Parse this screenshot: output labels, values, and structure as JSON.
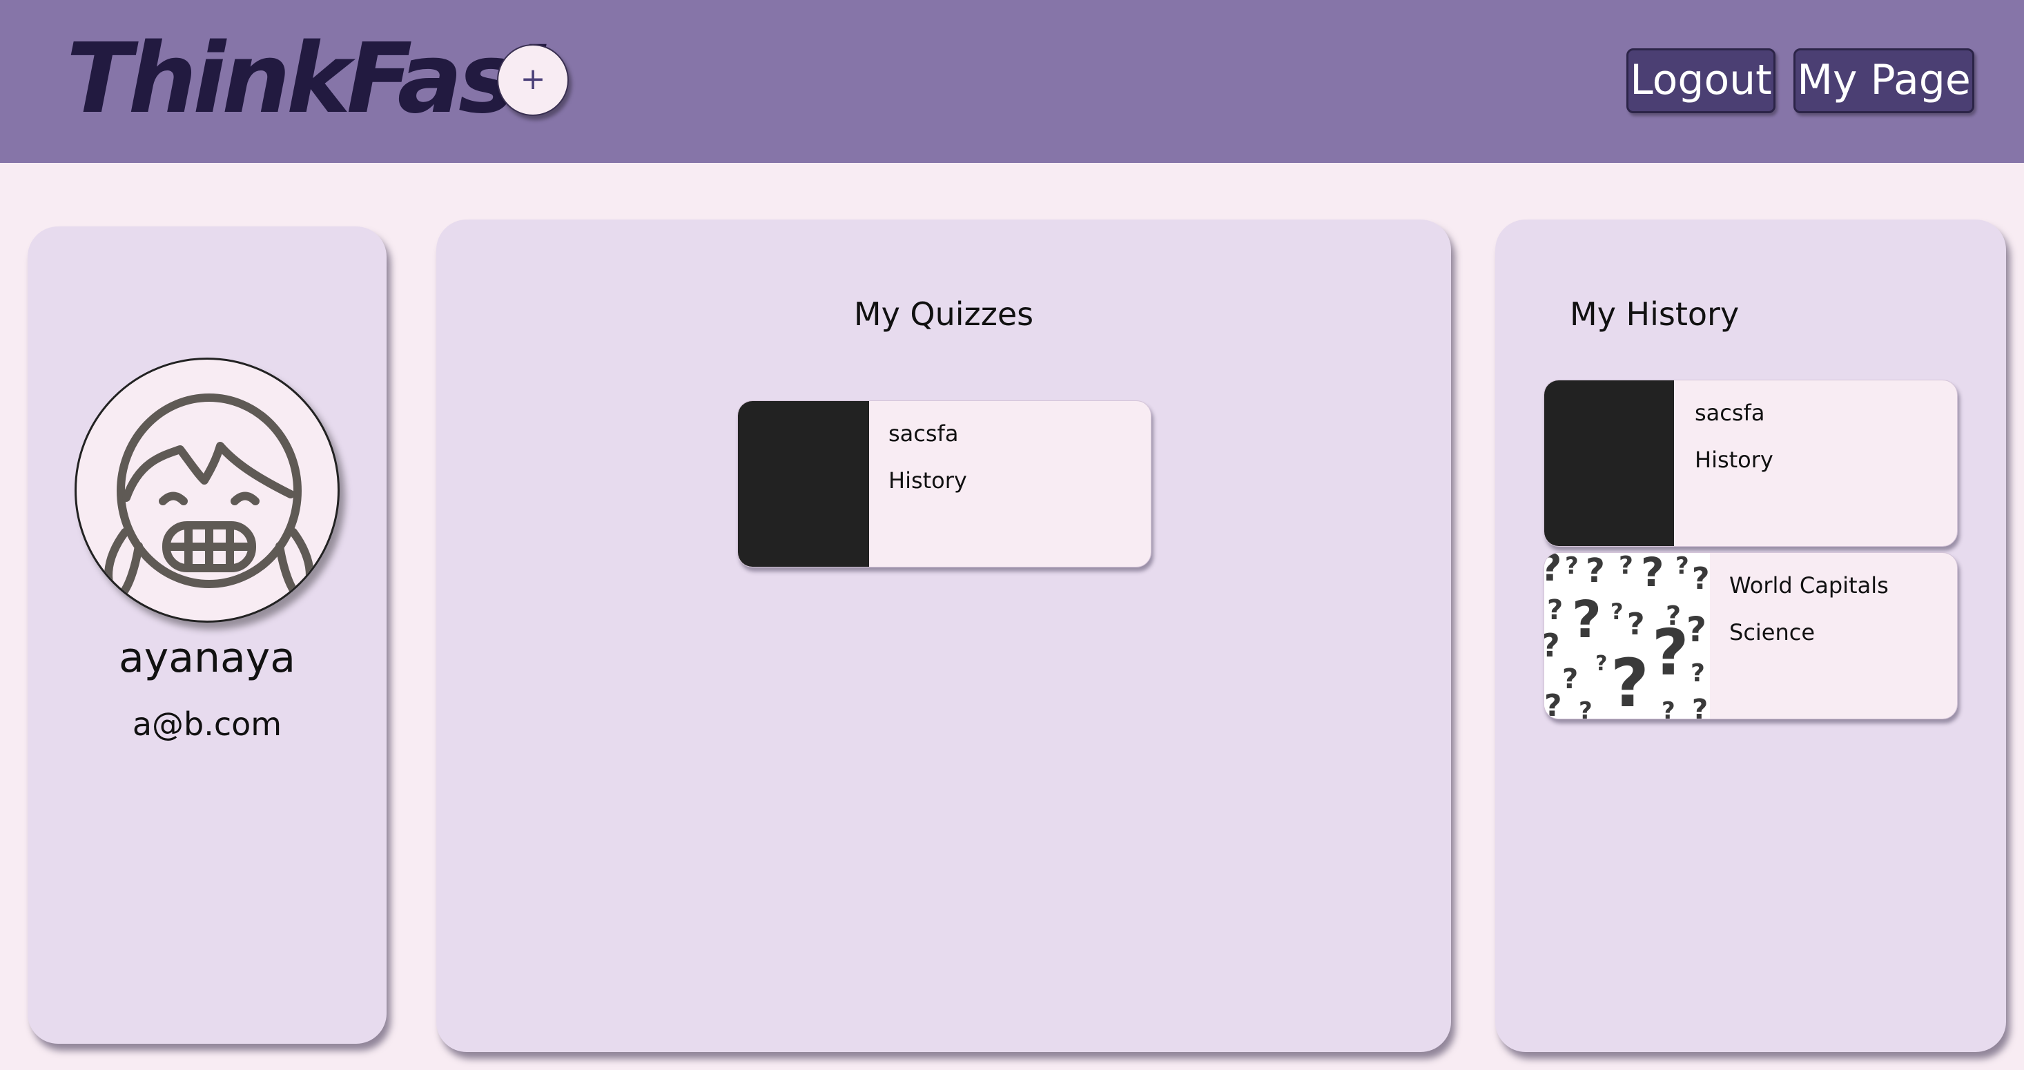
{
  "header": {
    "logo": "ThinkFast",
    "add_label": "+",
    "logout_label": "Logout",
    "mypage_label": "My Page"
  },
  "profile": {
    "username": "ayanaya",
    "email": "a@b.com",
    "avatar_icon": "girl-grinning-avatar-icon"
  },
  "my_quizzes": {
    "title": "My Quizzes",
    "items": [
      {
        "title": "sacsfa",
        "category": "History",
        "thumb": "black"
      }
    ]
  },
  "my_history": {
    "title": "My History",
    "items": [
      {
        "title": "sacsfa",
        "category": "History",
        "thumb": "black"
      },
      {
        "title": "World Capitals",
        "category": "Science",
        "thumb": "question-mark-pattern"
      }
    ]
  },
  "colors": {
    "header": "#8675a8",
    "page_bg": "#f8ecf3",
    "panel_bg": "#e7dbee",
    "button_bg": "#4b3f73",
    "logo": "#221a40"
  }
}
